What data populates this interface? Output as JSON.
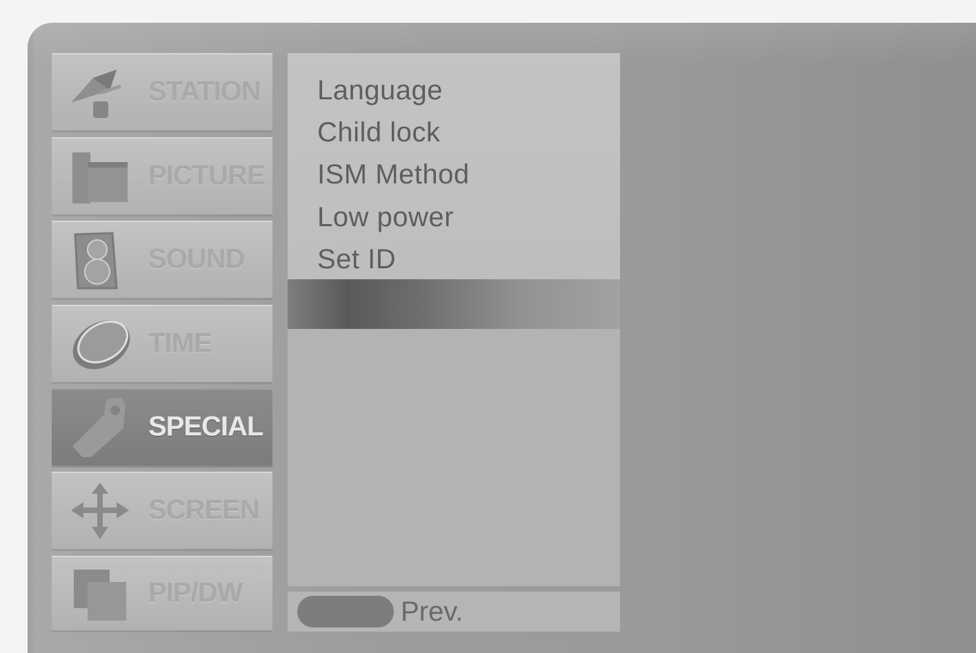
{
  "sidebar": {
    "items": [
      {
        "label": "STATION",
        "icon": "satellite-dish-icon",
        "active": false
      },
      {
        "label": "PICTURE",
        "icon": "picture-frame-icon",
        "active": false
      },
      {
        "label": "SOUND",
        "icon": "speaker-icon",
        "active": false
      },
      {
        "label": "TIME",
        "icon": "clock-icon",
        "active": false
      },
      {
        "label": "SPECIAL",
        "icon": "tag-icon",
        "active": true
      },
      {
        "label": "SCREEN",
        "icon": "move-arrows-icon",
        "active": false
      },
      {
        "label": "PIP/DW",
        "icon": "pip-windows-icon",
        "active": false
      }
    ]
  },
  "submenu": {
    "items": [
      "Language",
      "Child lock",
      "ISM Method",
      "Low power",
      "Set ID"
    ]
  },
  "footer": {
    "prev_label": "Prev."
  },
  "colors": {
    "active_item": "#848484",
    "panel": "#c0c0c0",
    "background": "#9d9d9d"
  }
}
